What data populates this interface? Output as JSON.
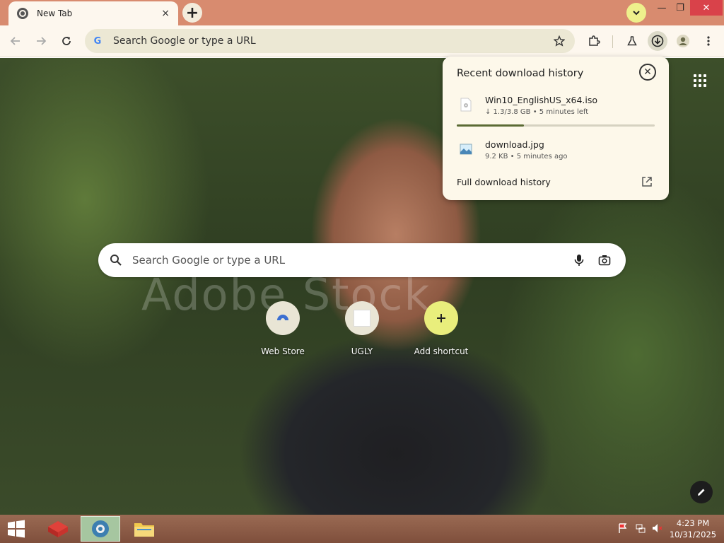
{
  "window": {
    "tab_title": "New Tab",
    "tab_close": "×",
    "new_tab": "+",
    "minimize": "—",
    "restore": "❐",
    "close": "✕"
  },
  "toolbar": {
    "omnibox_placeholder": "Search Google or type a URL",
    "icons": [
      "back-icon",
      "forward-icon",
      "reload-icon",
      "google-icon",
      "star-icon",
      "extensions-icon",
      "labs-flask-icon",
      "download-icon",
      "profile-icon",
      "menu-icon"
    ]
  },
  "ntp": {
    "search_placeholder": "Search Google or type a URL",
    "watermark": "Adobe Stock",
    "shortcuts": [
      {
        "label": "Web Store"
      },
      {
        "label": "UGLY"
      },
      {
        "label": "Add shortcut"
      }
    ]
  },
  "downloads": {
    "title": "Recent download history",
    "items": [
      {
        "name": "Win10_EnglishUS_x64.iso",
        "status": "↓ 1.3/3.8 GB • 5 minutes left",
        "progress": 0.34
      },
      {
        "name": "download.jpg",
        "status": "9.2 KB • 5 minutes ago"
      }
    ],
    "footer": "Full download history"
  },
  "taskbar": {
    "time": "4:23 PM",
    "date": "10/31/2025"
  },
  "colors": {
    "titlebar": "#d88b6f",
    "toolbar": "#fdf7ee",
    "accent_yellow": "#eef08c",
    "progress": "#5b6b34"
  }
}
